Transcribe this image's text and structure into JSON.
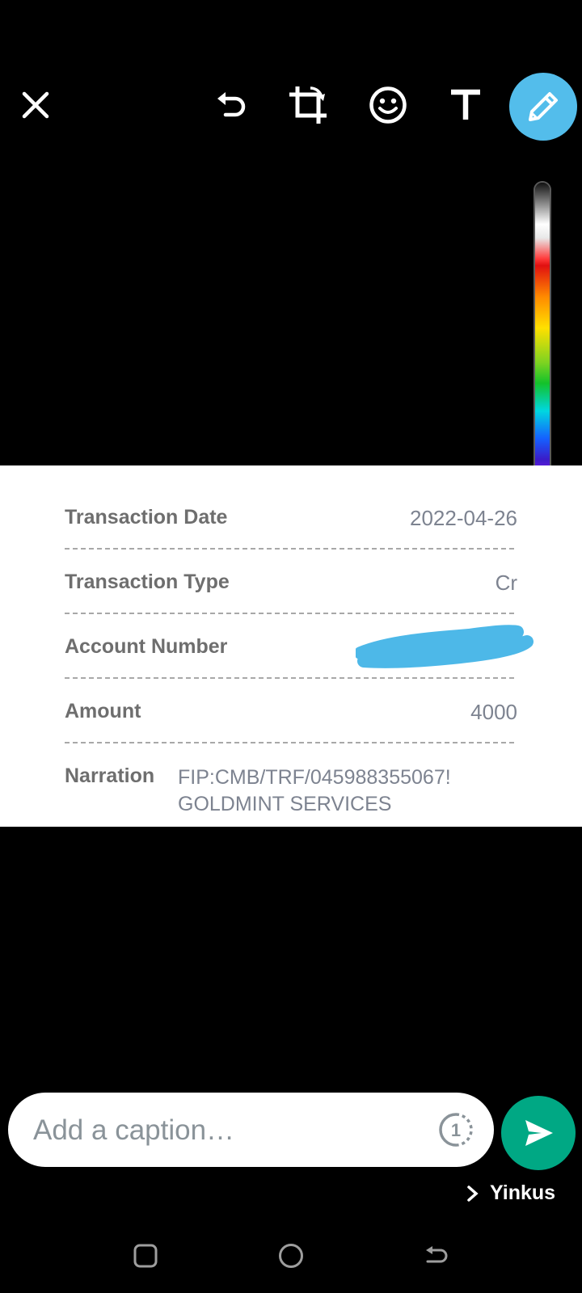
{
  "toolbar": {
    "icons": [
      "close-icon",
      "undo-icon",
      "crop-rotate-icon",
      "emoji-icon",
      "text-icon",
      "pencil-icon"
    ],
    "pen_active_color": "#53bdeb"
  },
  "receipt": {
    "rows": [
      {
        "label": "Transaction Date",
        "value": "2022-04-26"
      },
      {
        "label": "Transaction Type",
        "value": "Cr"
      },
      {
        "label": "Account Number",
        "value": ""
      },
      {
        "label": "Amount",
        "value": "4000"
      }
    ],
    "narration": {
      "label": "Narration",
      "line1": "FIP:CMB/TRF/045988355067!",
      "line2": "GOLDMINT SERVICES"
    },
    "scribble_color": "#4db8e8"
  },
  "caption": {
    "placeholder": "Add a caption…",
    "view_once_count": "1"
  },
  "recipient": {
    "name": "Yinkus"
  },
  "colors": {
    "send_button": "#00a884",
    "background": "#000000"
  }
}
